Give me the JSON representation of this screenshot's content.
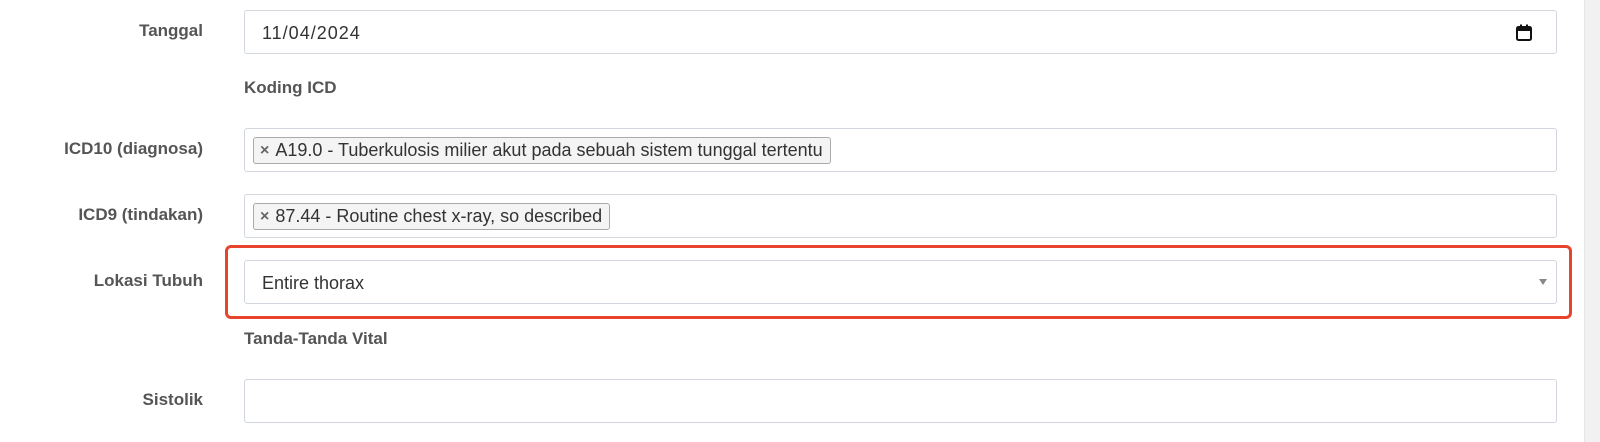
{
  "form": {
    "tanggal": {
      "label": "Tanggal",
      "value": "11/04/2024"
    },
    "section_icd": "Koding ICD",
    "icd10": {
      "label": "ICD10 (diagnosa)",
      "remove_symbol": "×",
      "selected": "A19.0 - Tuberkulosis milier akut pada sebuah sistem tunggal tertentu"
    },
    "icd9": {
      "label": "ICD9 (tindakan)",
      "remove_symbol": "×",
      "selected": "87.44 - Routine chest x-ray, so described"
    },
    "lokasi_tubuh": {
      "label": "Lokasi Tubuh",
      "value": "Entire thorax"
    },
    "section_vital": "Tanda-Tanda Vital",
    "sistolik": {
      "label": "Sistolik",
      "value": ""
    }
  },
  "colors": {
    "highlight": "#e8432c",
    "label": "#555555",
    "border": "#d2d6de"
  }
}
